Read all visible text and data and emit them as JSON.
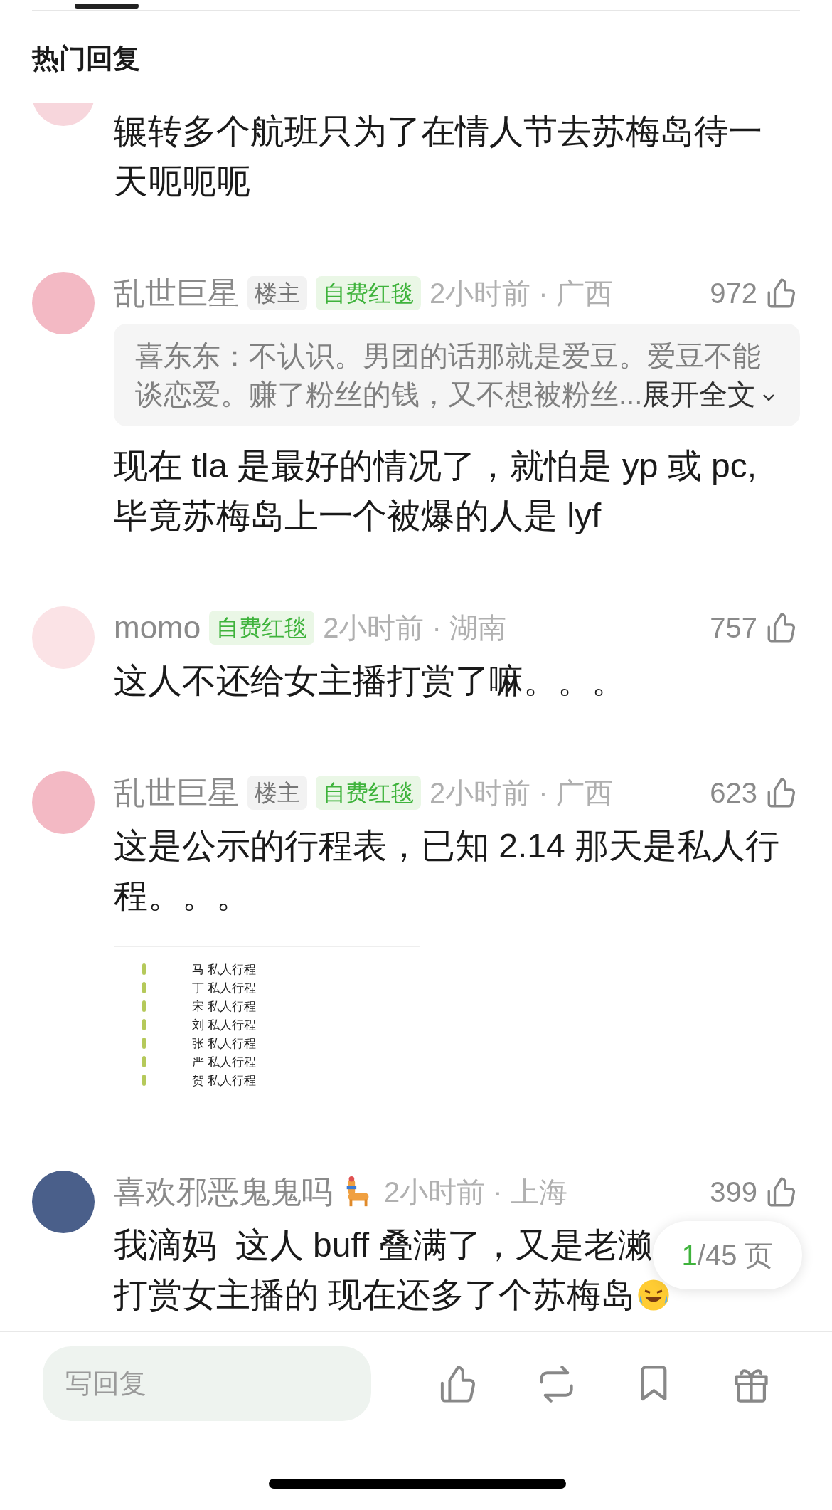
{
  "header": {
    "title": "热门回复"
  },
  "comments": [
    {
      "body_lines": [
        "辗转多个航班只为了在情人节去苏梅岛待一",
        "天呃呃呃"
      ]
    },
    {
      "name": "乱世巨星",
      "op_label": "楼主",
      "badge": "自费红毯",
      "time": "2小时前 · 广西",
      "likes": "972",
      "quote": {
        "text": "喜东东：不认识。男团的话那就是爱豆。爱豆不能谈恋爱。赚了粉丝的钱，又不想被粉丝...",
        "expand": "展开全文"
      },
      "body_lines": [
        "现在 tla 是最好的情况了，就怕是 yp 或 pc,",
        "毕竟苏梅岛上一个被爆的人是 lyf"
      ]
    },
    {
      "name": "momo",
      "badge": "自费红毯",
      "time": "2小时前 · 湖南",
      "likes": "757",
      "body_lines": [
        "这人不还给女主播打赏了嘛。。。"
      ]
    },
    {
      "name": "乱世巨星",
      "op_label": "楼主",
      "badge": "自费红毯",
      "time": "2小时前 · 广西",
      "likes": "623",
      "body_lines": [
        "这是公示的行程表，已知 2.14 那天是私人行",
        "程。。。"
      ],
      "schedule": [
        "马 私人行程",
        "丁 私人行程",
        "宋 私人行程",
        "刘 私人行程",
        "张 私人行程",
        "严 私人行程",
        "贺 私人行程"
      ]
    },
    {
      "name": "喜欢邪恶鬼鬼吗",
      "name_icon": true,
      "time": "2小时前 · 上海",
      "likes": "399",
      "body_lines": [
        "我滴妈  这人 buff 叠满了，又是老濑",
        "打赏女主播的 现在还多了个苏梅岛"
      ],
      "trailing_emoji": true
    }
  ],
  "pager": {
    "current": "1",
    "rest": "/45 页"
  },
  "reply_bar": {
    "placeholder": "写回复",
    "actions": [
      {
        "kind": "like"
      },
      {
        "kind": "repost"
      },
      {
        "kind": "bookmark"
      },
      {
        "kind": "gift"
      }
    ]
  }
}
